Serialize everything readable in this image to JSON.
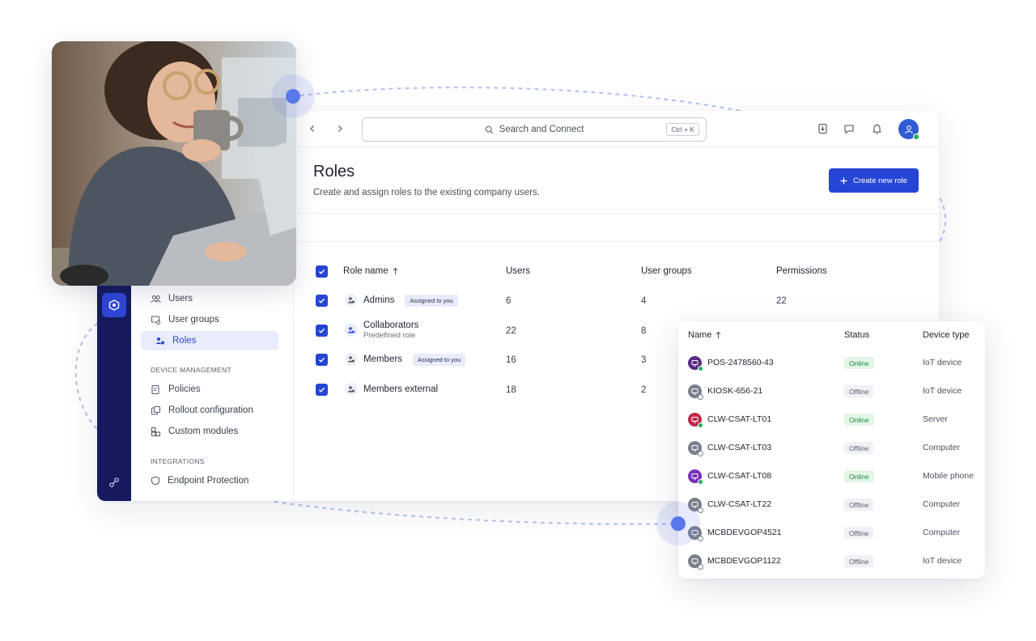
{
  "search": {
    "placeholder": "Search and Connect",
    "shortcut": "Ctrl + K"
  },
  "nav": {
    "items": [
      {
        "label": "Users",
        "icon": "users-icon"
      },
      {
        "label": "User groups",
        "icon": "user-groups-icon"
      },
      {
        "label": "Roles",
        "icon": "roles-icon",
        "active": true
      }
    ],
    "device_section": "DEVICE MANAGEMENT",
    "device_items": [
      {
        "label": "Policies",
        "icon": "policies-icon"
      },
      {
        "label": "Rollout configuration",
        "icon": "rollout-icon"
      },
      {
        "label": "Custom modules",
        "icon": "modules-icon"
      }
    ],
    "integrations_section": "INTEGRATIONS",
    "integration_items": [
      {
        "label": "Endpoint Protection",
        "icon": "shield-icon"
      }
    ]
  },
  "page": {
    "title": "Roles",
    "subtitle": "Create and assign roles to the existing company users.",
    "create_button": "Create new role"
  },
  "roles_table": {
    "headers": {
      "role_name": "Role name",
      "users": "Users",
      "user_groups": "User groups",
      "permissions": "Permissions"
    },
    "rows": [
      {
        "name": "Admins",
        "sub": "",
        "badge": "Assigned to you",
        "users": "6",
        "groups": "4",
        "permissions": "22"
      },
      {
        "name": "Collaborators",
        "sub": "Predefined role",
        "badge": "",
        "users": "22",
        "groups": "8",
        "permissions": ""
      },
      {
        "name": "Members",
        "sub": "",
        "badge": "Assigned to you",
        "users": "16",
        "groups": "3",
        "permissions": ""
      },
      {
        "name": "Members external",
        "sub": "",
        "badge": "",
        "users": "18",
        "groups": "2",
        "permissions": ""
      }
    ]
  },
  "devices": {
    "headers": {
      "name": "Name",
      "status": "Status",
      "type": "Device type"
    },
    "rows": [
      {
        "name": "POS-2478560-43",
        "status": "Online",
        "type": "IoT device",
        "icon_color": "#5b2a86"
      },
      {
        "name": "KIOSK-656-21",
        "status": "Offline",
        "type": "IoT device",
        "icon_color": "#7a7f8c"
      },
      {
        "name": "CLW-CSAT-LT01",
        "status": "Online",
        "type": "Server",
        "icon_color": "#c0284a"
      },
      {
        "name": "CLW-CSAT-LT03",
        "status": "Offline",
        "type": "Computer",
        "icon_color": "#7a7f8c"
      },
      {
        "name": "CLW-CSAT-LT08",
        "status": "Online",
        "type": "Mobile phone",
        "icon_color": "#7a2fb8"
      },
      {
        "name": "CLW-CSAT-LT22",
        "status": "Offline",
        "type": "Computer",
        "icon_color": "#7a7f8c"
      },
      {
        "name": "MCBDEVGOP4521",
        "status": "Offline",
        "type": "Computer",
        "icon_color": "#7a7f8c"
      },
      {
        "name": "MCBDEVGOP1122",
        "status": "Offline",
        "type": "IoT device",
        "icon_color": "#7a7f8c"
      }
    ]
  },
  "colors": {
    "accent": "#2645d4",
    "rail": "#151a5e",
    "online": "#22b060",
    "node": "#5a78ea"
  }
}
